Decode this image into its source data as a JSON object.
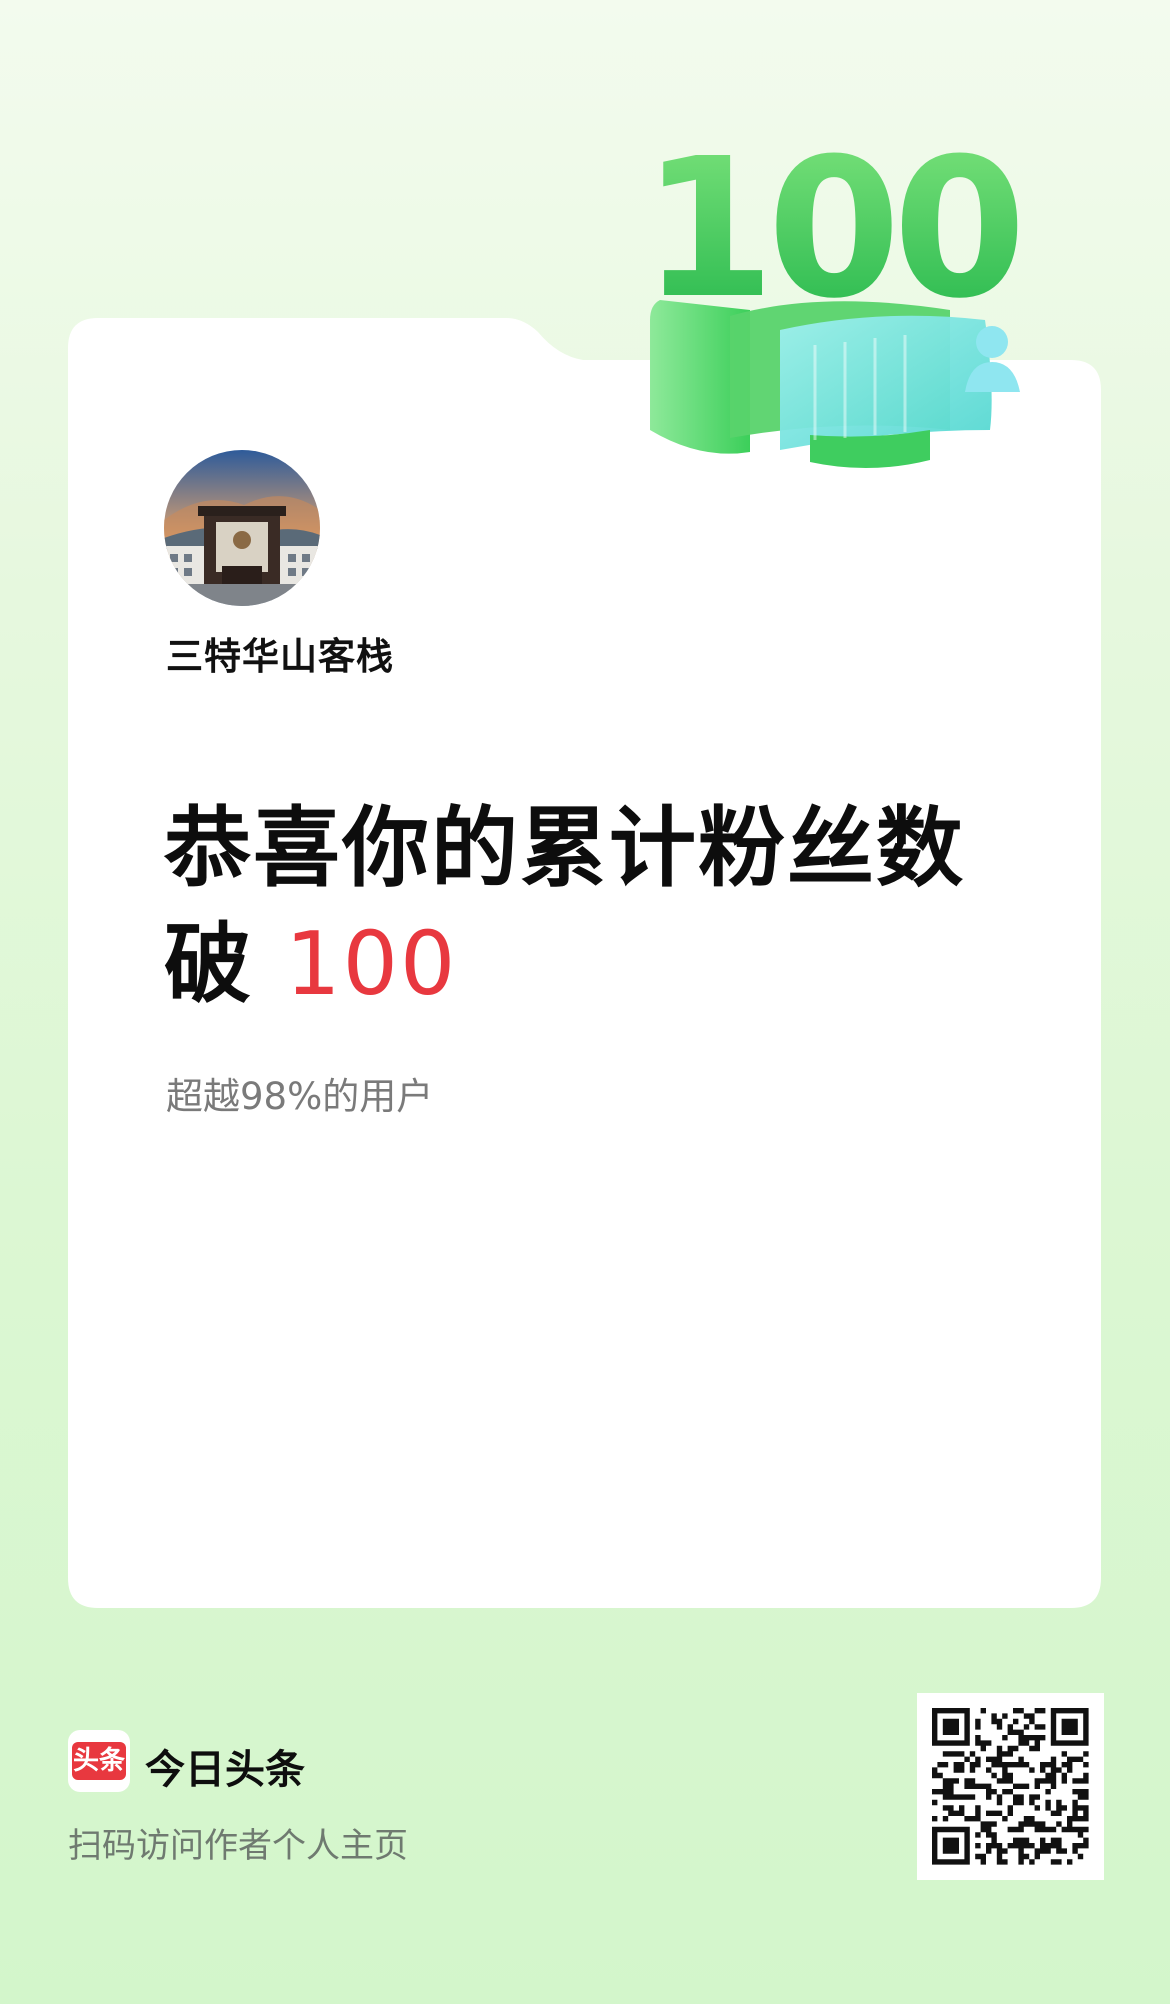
{
  "badge": {
    "number": "100",
    "icon": "person-icon"
  },
  "author": {
    "name": "三特华山客栈",
    "avatar": "building-photo-avatar"
  },
  "headline": {
    "text": "恭喜你的累计粉丝数破",
    "number": "100"
  },
  "subtitle": "超越98%的用户",
  "footer": {
    "logo_text": "头条",
    "app_name": "今日头条",
    "hint": "扫码访问作者个人主页",
    "qr_icon": "qr-code"
  },
  "colors": {
    "accent_red": "#e8383f",
    "badge_green": "#3ccf5a",
    "badge_cyan": "#6fe3df",
    "background_green": "#dcf7d3"
  }
}
